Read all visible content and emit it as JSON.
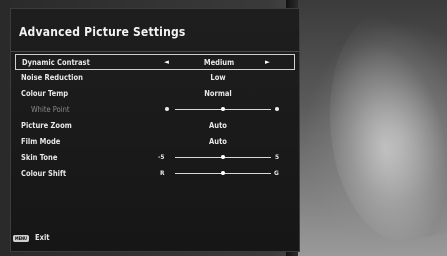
{
  "panel": {
    "title": "Advanced Picture Settings"
  },
  "settings": {
    "dynamic_contrast": {
      "label": "Dynamic Contrast",
      "value": "Medium",
      "left_arrow": "◄",
      "right_arrow": "►"
    },
    "noise_reduction": {
      "label": "Noise Reduction",
      "value": "Low"
    },
    "colour_temp": {
      "label": "Colour Temp",
      "value": "Normal"
    },
    "white_point": {
      "label": "White Point",
      "level": 0.5
    },
    "picture_zoom": {
      "label": "Picture Zoom",
      "value": "Auto"
    },
    "film_mode": {
      "label": "Film Mode",
      "value": "Auto"
    },
    "skin_tone": {
      "label": "Skin Tone",
      "min_label": "-5",
      "max_label": "5",
      "level": 0.5
    },
    "colour_shift": {
      "label": "Colour Shift",
      "min_label": "R",
      "max_label": "G",
      "level": 0.5
    }
  },
  "footer": {
    "menu_key": "MENU",
    "exit_label": "Exit"
  }
}
